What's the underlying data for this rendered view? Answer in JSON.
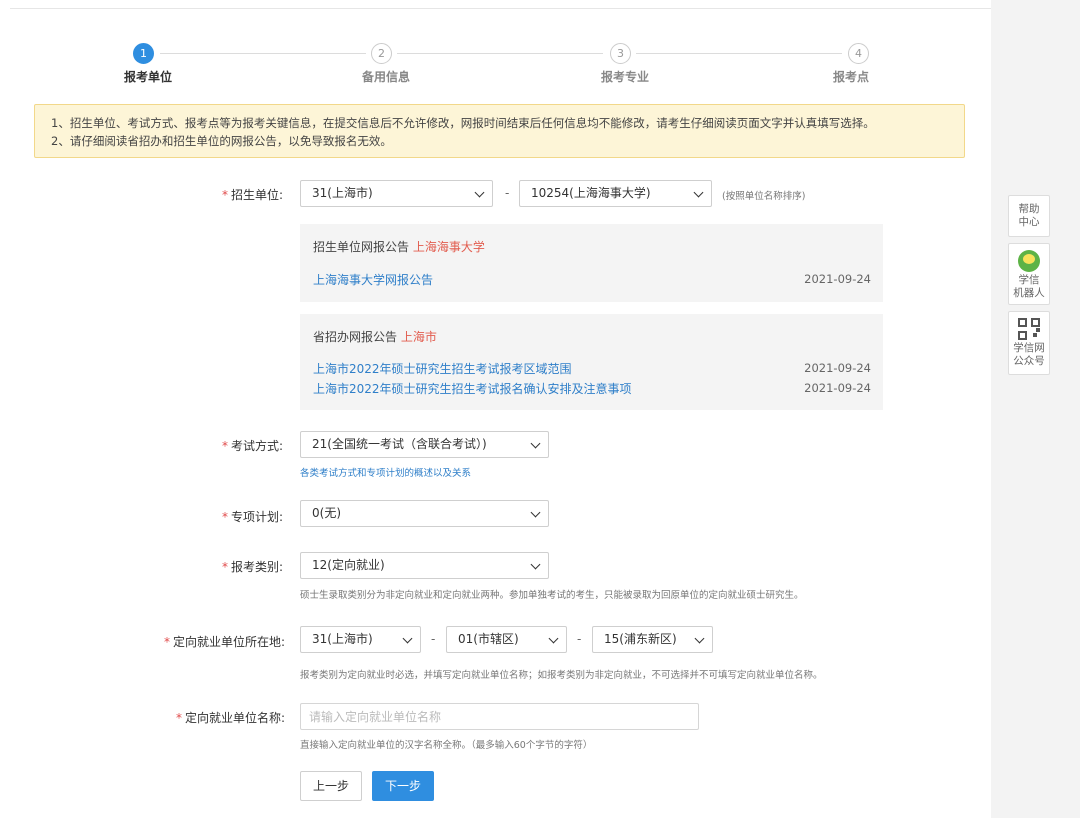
{
  "steps": [
    {
      "num": "1",
      "label": "报考单位"
    },
    {
      "num": "2",
      "label": "备用信息"
    },
    {
      "num": "3",
      "label": "报考专业"
    },
    {
      "num": "4",
      "label": "报考点"
    }
  ],
  "notice": {
    "line1": "1、招生单位、考试方式、报考点等为报考关键信息，在提交信息后不允许修改，网报时间结束后任何信息均不能修改，请考生仔细阅读页面文字并认真填写选择。",
    "line2": "2、请仔细阅读省招办和招生单位的网报公告，以免导致报名无效。"
  },
  "form": {
    "unit": {
      "label": "招生单位:",
      "province": "31(上海市)",
      "school": "10254(上海海事大学)",
      "hint": "(按照单位名称排序)"
    },
    "unit_notice": {
      "title": "招生单位网报公告",
      "title_highlight": "上海海事大学",
      "items": [
        {
          "text": "上海海事大学网报公告",
          "date": "2021-09-24"
        }
      ]
    },
    "province_notice": {
      "title": "省招办网报公告",
      "title_highlight": "上海市",
      "items": [
        {
          "text": "上海市2022年硕士研究生招生考试报考区域范围",
          "date": "2021-09-24"
        },
        {
          "text": "上海市2022年硕士研究生招生考试报名确认安排及注意事项",
          "date": "2021-09-24"
        }
      ]
    },
    "exam_mode": {
      "label": "考试方式:",
      "value": "21(全国统一考试（含联合考试）)",
      "hint": "各类考试方式和专项计划的概述以及关系"
    },
    "special_plan": {
      "label": "专项计划:",
      "value": "0(无)"
    },
    "apply_type": {
      "label": "报考类别:",
      "value": "12(定向就业)",
      "hint": "硕士生录取类别分为非定向就业和定向就业两种。参加单独考试的考生，只能被录取为回原单位的定向就业硕士研究生。"
    },
    "directed_location": {
      "label": "定向就业单位所在地:",
      "province": "31(上海市)",
      "city": "01(市辖区)",
      "district": "15(浦东新区)",
      "hint": "报考类别为定向就业时必选，并填写定向就业单位名称；如报考类别为非定向就业，不可选择并不可填写定向就业单位名称。"
    },
    "directed_name": {
      "label": "定向就业单位名称:",
      "placeholder": "请输入定向就业单位名称",
      "hint": "直接输入定向就业单位的汉字名称全称。（最多输入60个字节的字符）"
    }
  },
  "buttons": {
    "prev": "上一步",
    "next": "下一步"
  },
  "side": {
    "help": [
      "帮助",
      "中心"
    ],
    "robot": [
      "学信",
      "机器人"
    ],
    "wechat": [
      "学信网",
      "公众号"
    ]
  }
}
